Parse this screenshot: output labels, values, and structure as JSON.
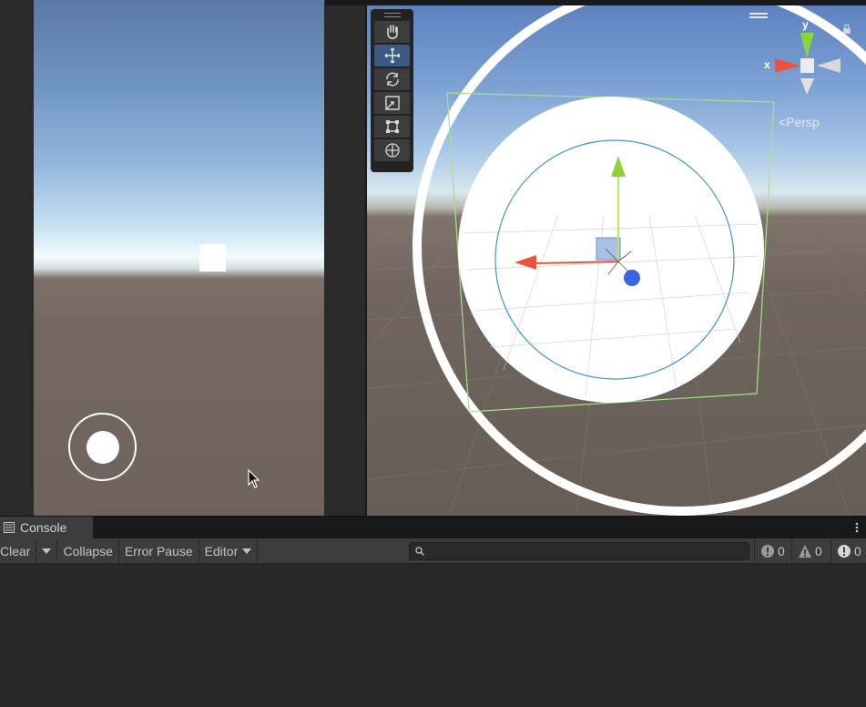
{
  "scene": {
    "camera_mode": "Persp",
    "axis_x": "x",
    "axis_y": "y",
    "tools": [
      {
        "name": "hand-tool",
        "active": false
      },
      {
        "name": "move-tool",
        "active": true
      },
      {
        "name": "rotate-tool",
        "active": false
      },
      {
        "name": "scale-tool",
        "active": false
      },
      {
        "name": "rect-tool",
        "active": false
      },
      {
        "name": "transform-tool",
        "active": false
      }
    ]
  },
  "console": {
    "tab_label": "Console",
    "clear_label": "Clear",
    "collapse_label": "Collapse",
    "error_pause_label": "Error Pause",
    "editor_label": "Editor",
    "search_placeholder": "",
    "log_count": "0",
    "warning_count": "0",
    "error_count": "0"
  },
  "colors": {
    "accent_active": "#3a5a84",
    "gizmo_x": "#e8543c",
    "gizmo_y": "#8ed33a",
    "gizmo_z": "#3c64e0",
    "bounds": "#a8e08a",
    "circle": "#3d98c8"
  }
}
